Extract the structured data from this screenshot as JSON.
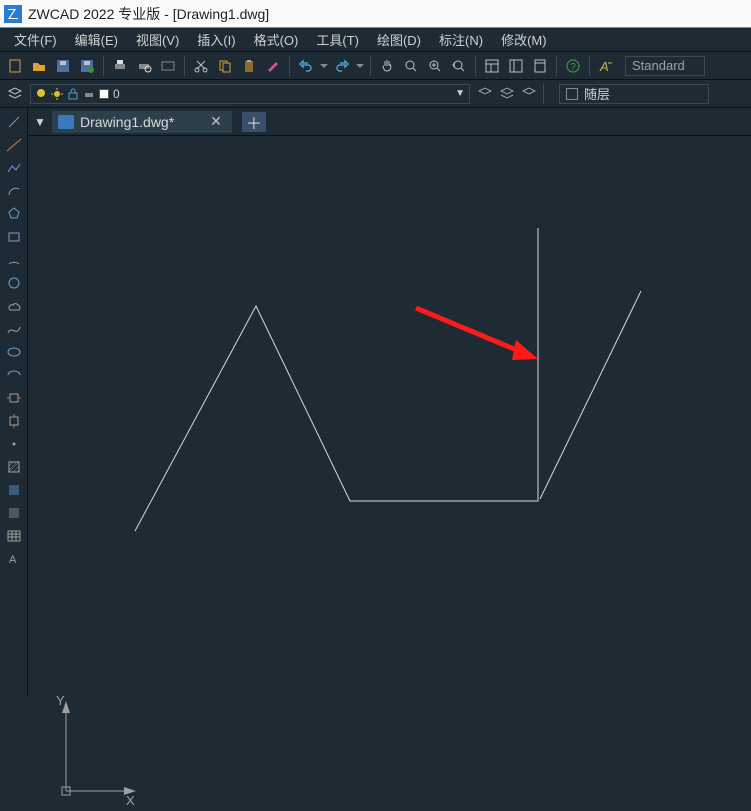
{
  "title": "ZWCAD 2022 专业版 - [Drawing1.dwg]",
  "menu": {
    "file": "文件(F)",
    "edit": "编辑(E)",
    "view": "视图(V)",
    "insert": "插入(I)",
    "format": "格式(O)",
    "tools": "工具(T)",
    "draw": "绘图(D)",
    "dimension": "标注(N)",
    "modify": "修改(M)"
  },
  "toolbar": {
    "style_name": "Standard"
  },
  "layer": {
    "current": "0",
    "bylayer": "随层"
  },
  "tab": {
    "document": "Drawing1.dwg*"
  },
  "ucs": {
    "x": "X",
    "y": "Y"
  }
}
